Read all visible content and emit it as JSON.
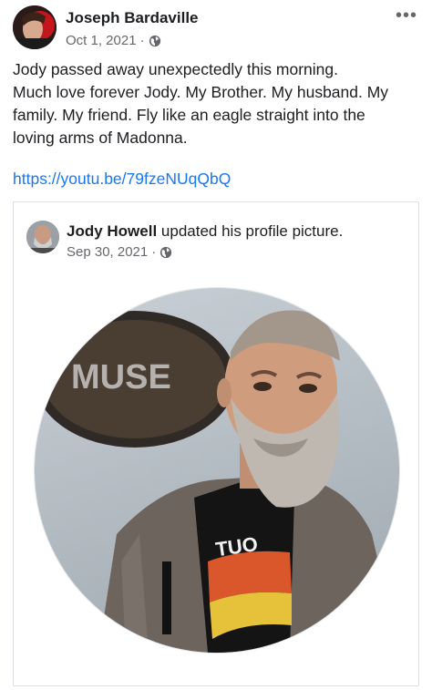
{
  "post": {
    "author": "Joseph Bardaville",
    "date": "Oct 1, 2021",
    "separator": "·",
    "privacy_icon": "globe-icon",
    "more_icon": "more-options-icon",
    "more_label": "•••",
    "body_lines": [
      "Jody passed away unexpectedly this morning.",
      "Much love forever Jody. My Brother. My husband. My",
      "family. My friend. Fly like an eagle straight into the",
      "loving arms of Madonna."
    ],
    "link": "https://youtu.be/79fzeNUqQbQ"
  },
  "shared": {
    "author": "Jody Howell",
    "action": "updated his profile picture.",
    "date": "Sep 30, 2021",
    "separator": "·",
    "privacy_icon": "globe-icon",
    "photo_sign_text": "MUSE",
    "shirt_text": "TUO"
  },
  "colors": {
    "link": "#1877f2",
    "meta": "#65676b",
    "text": "#1c1e21"
  }
}
